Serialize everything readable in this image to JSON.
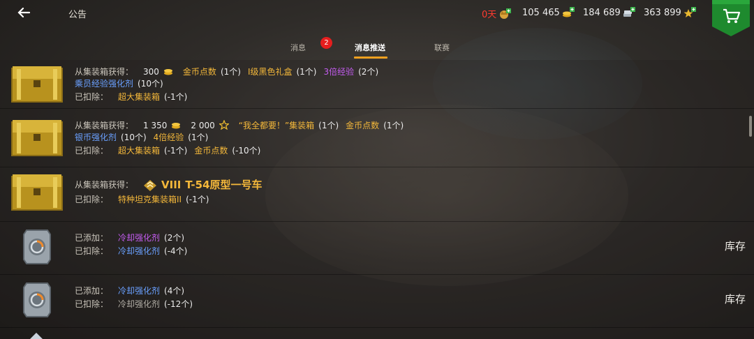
{
  "header": {
    "title": "公告",
    "days_value": "0天",
    "currency_silver_coins": "105 465",
    "currency_credits": "184 689",
    "currency_xp": "363 899"
  },
  "tabs": [
    {
      "label": "消息",
      "badge": "2"
    },
    {
      "label": "消息推送"
    },
    {
      "label": "联赛"
    }
  ],
  "rows": [
    {
      "line1": {
        "label": "从集装箱获得：",
        "coins": "300",
        "i1": "金币点数",
        "i1q": "(1个)",
        "i2": "I级黑色礼盒",
        "i2q": "(1个)",
        "i3": "3倍经验",
        "i3q": "(2个)"
      },
      "line2": {
        "i1": "乘员经验强化剂",
        "i1q": "(10个)"
      },
      "line3": {
        "label": "已扣除：",
        "i1": "超大集装箱",
        "i1q": "(-1个)"
      }
    },
    {
      "line1": {
        "label": "从集装箱获得：",
        "coins": "1 350",
        "xp": "2 000",
        "i1": "“我全都要！”集装箱",
        "i1q": "(1个)",
        "i2": "金币点数",
        "i2q": "(1个)"
      },
      "line2": {
        "i1": "银币强化剂",
        "i1q": "(10个)",
        "i2": "4倍经验",
        "i2q": "(1个)"
      },
      "line3": {
        "label": "已扣除：",
        "i1": "超大集装箱",
        "i1q": "(-1个)",
        "i2": "金币点数",
        "i2q": "(-10个)"
      }
    },
    {
      "line1": {
        "label": "从集装箱获得：",
        "tier": "VIII",
        "tank": "T-54原型一号车"
      },
      "line3": {
        "label": "已扣除：",
        "i1": "特种坦克集装箱II",
        "i1q": "(-1个)"
      }
    },
    {
      "line1": {
        "label": "已添加：",
        "i1": "冷却强化剂",
        "i1q": "(2个)"
      },
      "line2": {
        "label": "已扣除：",
        "i1": "冷却强化剂",
        "i1q": "(-4个)"
      },
      "button": "库存"
    },
    {
      "line1": {
        "label": "已添加：",
        "i1": "冷却强化剂",
        "i1q": "(4个)"
      },
      "line2": {
        "label": "已扣除：",
        "i1": "冷却强化剂",
        "i1q": "(-12个)"
      },
      "button": "库存"
    }
  ],
  "colors": {
    "accent": "#f1a020",
    "gold": "#f3b73a",
    "purple": "#c45cf0",
    "blue": "#6aa0ff",
    "badge": "#e51e1e",
    "shop": "#1e8a2e"
  },
  "icons": [
    "back-arrow-icon",
    "premium-days-icon",
    "gold-coins-icon",
    "silver-credits-icon",
    "free-xp-icon",
    "shopping-cart-icon",
    "gold-crate-icon",
    "cooldown-booster-icon",
    "tier-rank-icon"
  ]
}
